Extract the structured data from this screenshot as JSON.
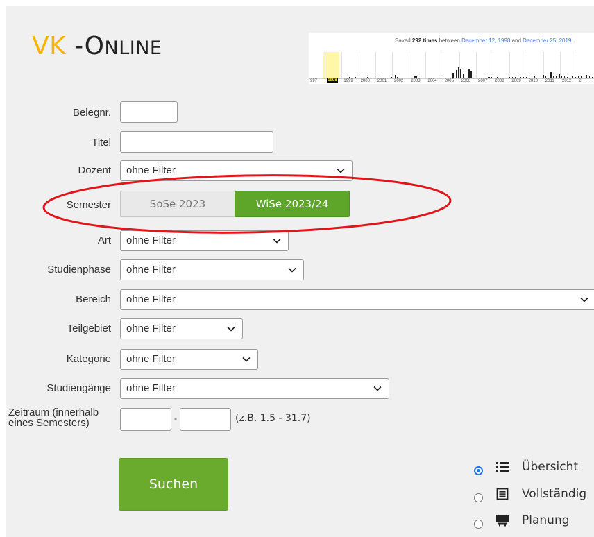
{
  "logo": {
    "part1": "VK",
    "part2": " -O",
    "part3": "NLINE"
  },
  "wayback": {
    "saved_prefix": "Saved ",
    "saved_count": "292 times",
    "between": " between ",
    "date_start": "December 12, 1998",
    "and": " and ",
    "date_end": "December 25, 2019.",
    "years": [
      "997",
      "1998",
      "1999",
      "2000",
      "2001",
      "2002",
      "2003",
      "2004",
      "2005",
      "2006",
      "2007",
      "2008",
      "2009",
      "2010",
      "2011",
      "2012",
      "2"
    ],
    "selected_year": "1998"
  },
  "form": {
    "belegnr_label": "Belegnr.",
    "titel_label": "Titel",
    "dozent_label": "Dozent",
    "dozent_value": "ohne Filter",
    "semester_label": "Semester",
    "semester_options": [
      "SoSe 2023",
      "WiSe 2023/24"
    ],
    "semester_selected": "WiSe 2023/24",
    "art_label": "Art",
    "art_value": "ohne Filter",
    "studienphase_label": "Studienphase",
    "studienphase_value": "ohne Filter",
    "bereich_label": "Bereich",
    "bereich_value": "ohne Filter",
    "teilgebiet_label": "Teilgebiet",
    "teilgebiet_value": "ohne Filter",
    "kategorie_label": "Kategorie",
    "kategorie_value": "ohne Filter",
    "studiengaenge_label": "Studiengänge",
    "studiengaenge_value": "ohne Filter",
    "zeitraum_label_line1": "Zeitraum (innerhalb",
    "zeitraum_label_line2": "eines Semesters)",
    "zeitraum_separator": "-",
    "zeitraum_hint": "(z.B. 1.5 - 31.7)",
    "search_button": "Suchen"
  },
  "view_options": [
    {
      "label": "Übersicht",
      "icon": "list-icon",
      "selected": true
    },
    {
      "label": "Vollständig",
      "icon": "document-icon",
      "selected": false
    },
    {
      "label": "Planung",
      "icon": "presentation-icon",
      "selected": false
    }
  ],
  "annotation_color": "#e0161b",
  "colors": {
    "accent_green": "#5ea62a",
    "logo_yellow": "#f7b500"
  }
}
